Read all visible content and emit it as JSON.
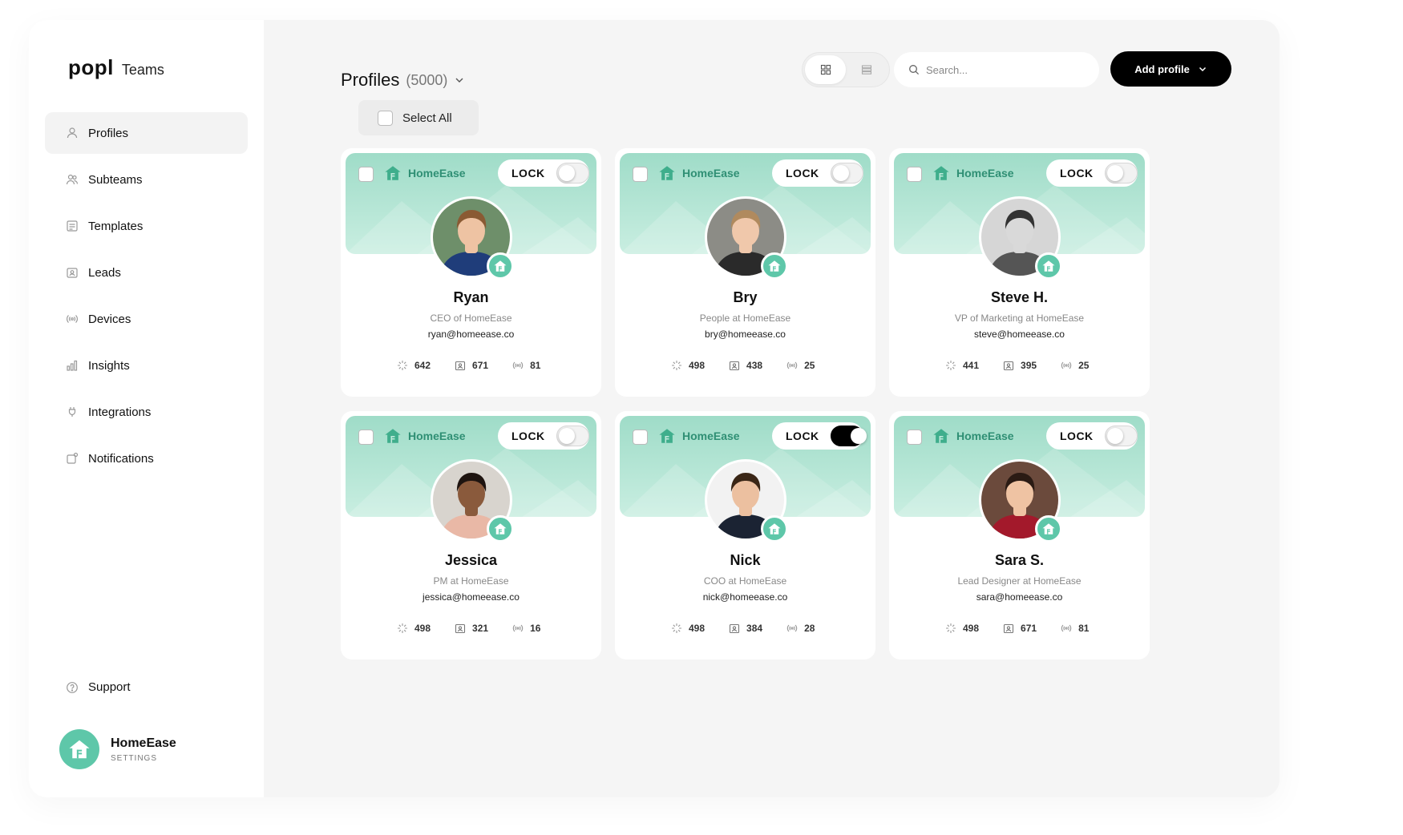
{
  "sidebar": {
    "logo": "popl",
    "logo_sub": "Teams",
    "items": [
      {
        "label": "Profiles",
        "icon": "person-icon"
      },
      {
        "label": "Subteams",
        "icon": "people-icon"
      },
      {
        "label": "Templates",
        "icon": "template-icon"
      },
      {
        "label": "Leads",
        "icon": "contact-card-icon"
      },
      {
        "label": "Devices",
        "icon": "broadcast-icon"
      },
      {
        "label": "Insights",
        "icon": "bar-chart-icon"
      },
      {
        "label": "Integrations",
        "icon": "plug-icon"
      },
      {
        "label": "Notifications",
        "icon": "bell-icon"
      }
    ],
    "support": "Support",
    "org": {
      "name": "HomeEase",
      "settings": "SETTINGS"
    }
  },
  "header": {
    "title": "Profiles",
    "count": "(5000)",
    "search_placeholder": "Search...",
    "add_label": "Add profile",
    "select_all": "Select All"
  },
  "card_common": {
    "brand": "HomeEase",
    "lock_label": "LOCK"
  },
  "colors": {
    "accent": "#5ec7a9",
    "banner_top": "#9fdcc8",
    "banner_bottom": "#c9eee1",
    "brand_text": "#2f8f74"
  },
  "profiles": [
    {
      "name": "Ryan",
      "role": "CEO of HomeEase",
      "email": "ryan@homeease.co",
      "views": "642",
      "leads": "671",
      "taps": "81",
      "locked": false
    },
    {
      "name": "Bry",
      "role": "People at HomeEase",
      "email": "bry@homeease.co",
      "views": "498",
      "leads": "438",
      "taps": "25",
      "locked": false
    },
    {
      "name": "Steve H.",
      "role": "VP of Marketing at HomeEase",
      "email": "steve@homeease.co",
      "views": "441",
      "leads": "395",
      "taps": "25",
      "locked": false
    },
    {
      "name": "Jessica",
      "role": "PM at HomeEase",
      "email": "jessica@homeease.co",
      "views": "498",
      "leads": "321",
      "taps": "16",
      "locked": false
    },
    {
      "name": "Nick",
      "role": "COO at HomeEase",
      "email": "nick@homeease.co",
      "views": "498",
      "leads": "384",
      "taps": "28",
      "locked": true
    },
    {
      "name": "Sara S.",
      "role": "Lead Designer at HomeEase",
      "email": "sara@homeease.co",
      "views": "498",
      "leads": "671",
      "taps": "81",
      "locked": false
    }
  ]
}
